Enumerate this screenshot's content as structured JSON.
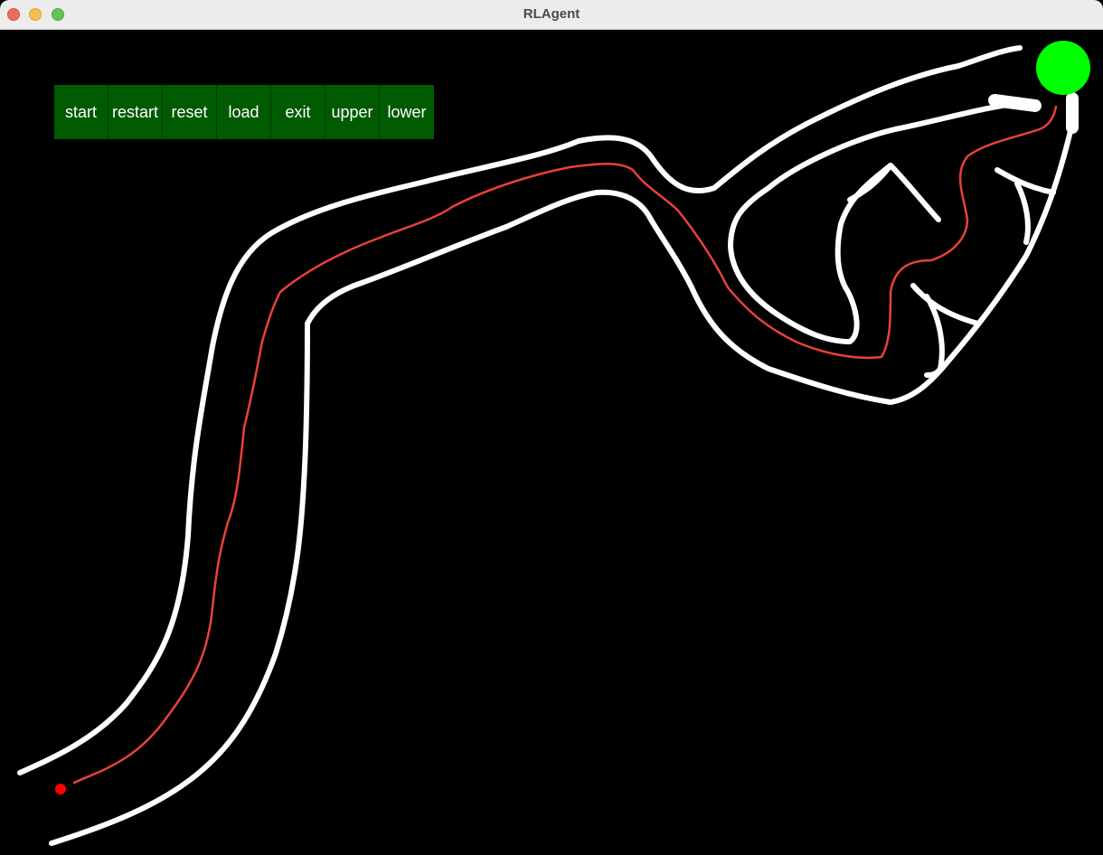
{
  "window": {
    "title": "RLAgent"
  },
  "toolbar": {
    "buttons": [
      {
        "id": "start",
        "label": "start"
      },
      {
        "id": "restart",
        "label": "restart"
      },
      {
        "id": "reset",
        "label": "reset"
      },
      {
        "id": "load",
        "label": "load"
      },
      {
        "id": "exit",
        "label": "exit"
      },
      {
        "id": "upper",
        "label": "upper"
      },
      {
        "id": "lower",
        "label": "lower"
      }
    ],
    "button_color": "#005a00"
  },
  "canvas": {
    "background_color": "#000000",
    "track_color": "#ffffff",
    "agent_path_color": "#e8413a",
    "agent_color": "#ff0000",
    "goal_color": "#00ff00"
  }
}
